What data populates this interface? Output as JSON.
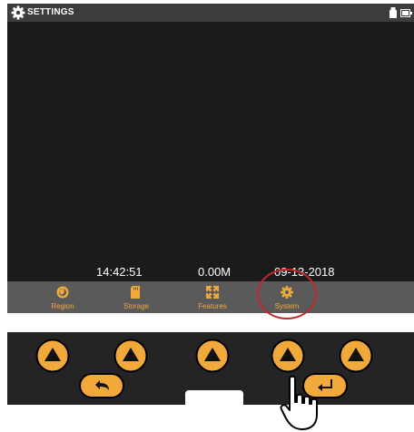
{
  "header": {
    "title": "SETTINGS",
    "icon": "gear-icon",
    "status_icons": [
      "usb-icon",
      "battery-icon"
    ]
  },
  "status_bar": {
    "time": "14:42:51",
    "storage": "0.00M",
    "date": "09-13-2018"
  },
  "menu": {
    "items": [
      {
        "label": "Region",
        "icon": "region-icon"
      },
      {
        "label": "Storage",
        "icon": "sd-card-icon"
      },
      {
        "label": "Features",
        "icon": "features-icon"
      },
      {
        "label": "System",
        "icon": "gear-icon",
        "highlighted": true
      }
    ]
  },
  "hardware_buttons": {
    "up_buttons": 5,
    "back_icon": "back-arrow-icon",
    "enter_icon": "enter-return-icon"
  },
  "colors": {
    "accent": "#f2a93b",
    "screen_bg": "#1c1b1b",
    "titlebar_bg": "#3c3c3c",
    "menu_bg": "#5a5a5a",
    "panel_bg": "#242424",
    "highlight_ring": "#c1272d"
  }
}
